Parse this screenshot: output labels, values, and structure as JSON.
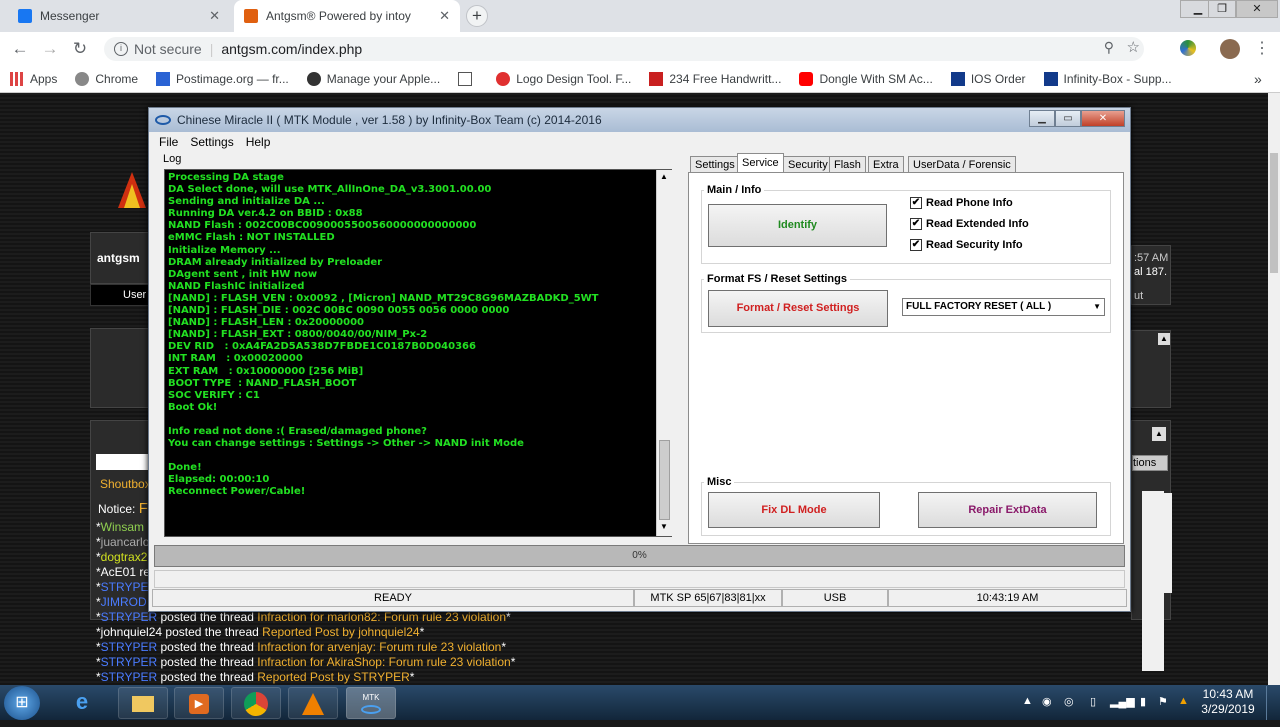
{
  "browser": {
    "tabs": [
      {
        "title": "Messenger",
        "icon_color": "#1877f2"
      },
      {
        "title": "Antgsm® Powered by intoy",
        "icon_color": "#e06010"
      }
    ],
    "tab_close": "✕",
    "new_tab": "+",
    "url_security": "Not secure",
    "url": "antgsm.com/index.php",
    "bookmarks": [
      {
        "label": "Apps",
        "icon_color": "#d44"
      },
      {
        "label": "Chrome",
        "icon_color": "#888"
      },
      {
        "label": "Postimage.org — fr...",
        "icon_color": "#2a63d4"
      },
      {
        "label": "Manage your Apple...",
        "icon_color": "#333"
      },
      {
        "label": "",
        "icon_color": "#555"
      },
      {
        "label": "Logo Design Tool. F...",
        "icon_color": "#e03030"
      },
      {
        "label": "234 Free Handwritt...",
        "icon_color": "#c92020"
      },
      {
        "label": "Dongle With SM Ac...",
        "icon_color": "#f00"
      },
      {
        "label": "IOS Order",
        "icon_color": "#123a8a"
      },
      {
        "label": "Infinity-Box - Supp...",
        "icon_color": "#123a8a"
      }
    ],
    "more": "»"
  },
  "site": {
    "left_username": "antgsm",
    "left_user": "User",
    "right_time": ":57 AM",
    "right_count": "al 187.",
    "right_tab": "ut",
    "options_label": "tions",
    "shoutbox": "Shoutbox",
    "notice_label": "Notice:",
    "notice_text": "Fo",
    "shout_lines": [
      {
        "user": "Winsam",
        "text": ""
      },
      {
        "user": "juancarlo",
        "text": ""
      },
      {
        "user": "dogtrax2",
        "text": ""
      },
      {
        "user": "AcE01",
        "text": "re"
      },
      {
        "user": "STRYPER",
        "text": ""
      },
      {
        "user": "JIMROD",
        "text": ""
      },
      {
        "user": "STRYPER",
        "text": "posted the thread",
        "title": "Infraction for marlon82: Forum rule 23 violation"
      },
      {
        "user": "johnquiel24",
        "text": "posted the thread",
        "title": "Reported Post by johnquiel24"
      },
      {
        "user": "STRYPER",
        "text": "posted the thread",
        "title": "Infraction for arvenjay: Forum rule 23 violation"
      },
      {
        "user": "STRYPER",
        "text": "posted the thread",
        "title": "Infraction for AkiraShop: Forum rule 23 violation"
      },
      {
        "user": "STRYPER",
        "text": "posted the thread",
        "title": "Reported Post by STRYPER"
      }
    ]
  },
  "app": {
    "title": "Chinese Miracle II ( MTK Module , ver 1.58 ) by Infinity-Box Team (c) 2014-2016",
    "menu": [
      "File",
      "Settings",
      "Help"
    ],
    "log_label": "Log",
    "log_lines": [
      "Processing DA stage",
      "DA Select done, will use MTK_AllInOne_DA_v3.3001.00.00",
      "Sending and initialize DA ...",
      "Running DA ver.4.2 on BBID : 0x88",
      "NAND Flash : 002C00BC0090005500560000000000000",
      "eMMC Flash : NOT INSTALLED",
      "Initialize Memory ...",
      "DRAM already initialized by Preloader",
      "DAgent sent , init HW now",
      "NAND FlashIC initialized",
      "[NAND] : FLASH_VEN : 0x0092 , [Micron] NAND_MT29C8G96MAZBADKD_5WT",
      "[NAND] : FLASH_DIE : 002C 00BC 0090 0055 0056 0000 0000",
      "[NAND] : FLASH_LEN : 0x20000000",
      "[NAND] : FLASH_EXT : 0800/0040/00/NIM_Px-2",
      "DEV RID   : 0xA4FA2D5A538D7FBDE1C0187B0D040366",
      "INT RAM   : 0x00020000",
      "EXT RAM   : 0x10000000 [256 MiB]",
      "BOOT TYPE  : NAND_FLASH_BOOT",
      "SOC VERIFY : C1",
      "Boot Ok!",
      "",
      "Info read not done :( Erased/damaged phone?",
      "You can change settings : Settings -> Other -> NAND init Mode",
      "",
      "Done!",
      "Elapsed: 00:00:10",
      "Reconnect Power/Cable!"
    ],
    "tabs": [
      "Settings",
      "Service",
      "Security",
      "Flash",
      "Extra",
      "UserData / Forensic"
    ],
    "active_tab": "Service",
    "main_info": {
      "title": "Main / Info",
      "identify": "Identify",
      "checks": [
        {
          "label": "Read Phone Info",
          "checked": true
        },
        {
          "label": "Read Extended Info",
          "checked": true
        },
        {
          "label": "Read Security Info",
          "checked": true
        }
      ]
    },
    "format": {
      "title": "Format FS / Reset Settings",
      "button": "Format / Reset Settings",
      "select": "FULL FACTORY RESET ( ALL )"
    },
    "misc": {
      "title": "Misc",
      "fix_dl": "Fix DL Mode",
      "repair": "Repair ExtData"
    },
    "progress": "0%",
    "status": [
      "READY",
      "MTK SP 65|67|83|81|xx",
      "USB",
      "10:43:19 AM"
    ]
  },
  "taskbar": {
    "time": "10:43 AM",
    "date": "3/29/2019"
  },
  "colors": {
    "log_text": "#22e022",
    "identify": "#1f8a1f",
    "format_btn": "#d02020",
    "fix_dl": "#d02020",
    "repair": "#8a1a6a"
  }
}
